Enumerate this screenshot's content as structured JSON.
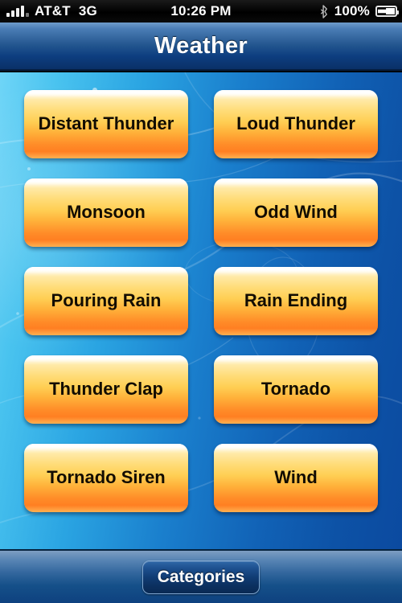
{
  "status_bar": {
    "carrier": "AT&T",
    "network": "3G",
    "time": "10:26 PM",
    "battery_percent": "100%",
    "signal_icon": "signal-bars-icon",
    "bluetooth_icon": "bluetooth-icon",
    "battery_icon": "battery-charging-icon"
  },
  "nav": {
    "title": "Weather"
  },
  "buttons": [
    {
      "label": "Distant Thunder"
    },
    {
      "label": "Loud Thunder"
    },
    {
      "label": "Monsoon"
    },
    {
      "label": "Odd Wind"
    },
    {
      "label": "Pouring Rain"
    },
    {
      "label": "Rain Ending"
    },
    {
      "label": "Thunder Clap"
    },
    {
      "label": "Tornado"
    },
    {
      "label": "Tornado Siren"
    },
    {
      "label": "Wind"
    }
  ],
  "toolbar": {
    "categories_label": "Categories"
  },
  "colors": {
    "button_top": "#ffffff",
    "button_mid": "#ffcf54",
    "button_bottom": "#ff7f22",
    "background_left": "#6fd5f7",
    "background_right": "#0b4aa0",
    "nav_bar_top": "#6f9ccb",
    "nav_bar_bottom": "#0a3067",
    "text_dark": "#120c02",
    "text_light": "#ffffff"
  }
}
